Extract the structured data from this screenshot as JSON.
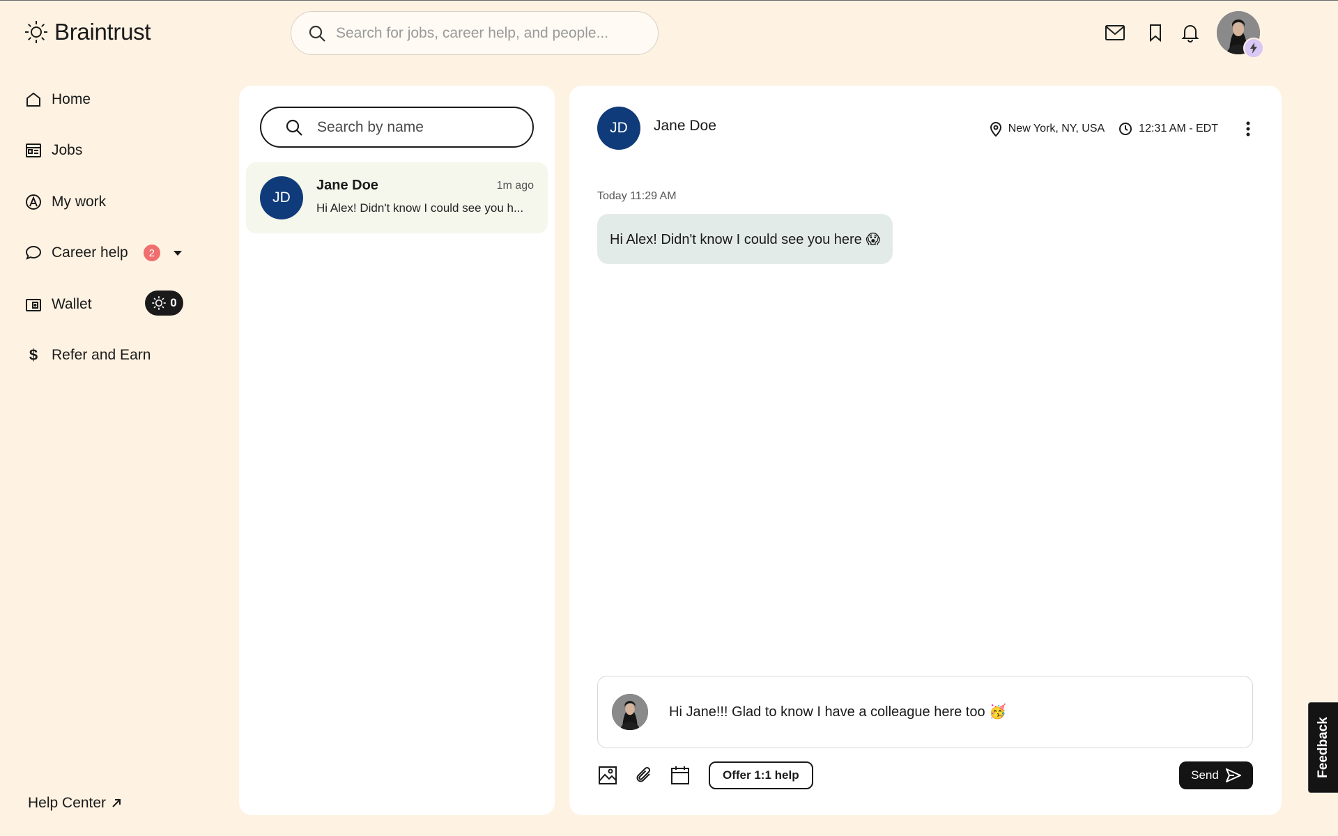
{
  "app": {
    "brand": "Braintrust",
    "search_placeholder": "Search for jobs, career help, and people..."
  },
  "header_icons": [
    "mail-icon",
    "bookmark-icon",
    "bell-icon"
  ],
  "sidebar": {
    "items": [
      {
        "label": "Home",
        "icon": "home-icon"
      },
      {
        "label": "Jobs",
        "icon": "jobs-icon"
      },
      {
        "label": "My work",
        "icon": "my-work-icon"
      },
      {
        "label": "Career help",
        "icon": "chat-bubble-icon",
        "badge": "2"
      },
      {
        "label": "Wallet",
        "icon": "wallet-icon",
        "balance": "0"
      },
      {
        "label": "Refer and Earn",
        "icon": "dollar-icon"
      }
    ],
    "help_center": "Help Center"
  },
  "conversations": {
    "search_placeholder": "Search by name",
    "items": [
      {
        "initials": "JD",
        "name": "Jane Doe",
        "time": "1m ago",
        "preview": "Hi Alex! Didn't know I could see you h..."
      }
    ]
  },
  "chat": {
    "contact": {
      "initials": "JD",
      "name": "Jane Doe",
      "location": "New York, NY, USA",
      "local_time": "12:31 AM - EDT"
    },
    "messages": [
      {
        "date": "Today 11:29 AM",
        "text": "Hi Alex! Didn't know I could see you here 😱"
      }
    ],
    "composer": {
      "value": "Hi Jane!!! Glad to know I have a colleague here too 🥳"
    },
    "toolbar": {
      "offer_label": "Offer 1:1 help",
      "send_label": "Send"
    }
  },
  "feedback_label": "Feedback",
  "colors": {
    "background": "#fef2e2",
    "panel": "#ffffff",
    "avatar_blue": "#0f3b7a",
    "badge_red": "#f06e6e",
    "bubble": "#e3ebe8",
    "selected_conversation": "#f5f7ec",
    "dark_button": "#141414"
  }
}
